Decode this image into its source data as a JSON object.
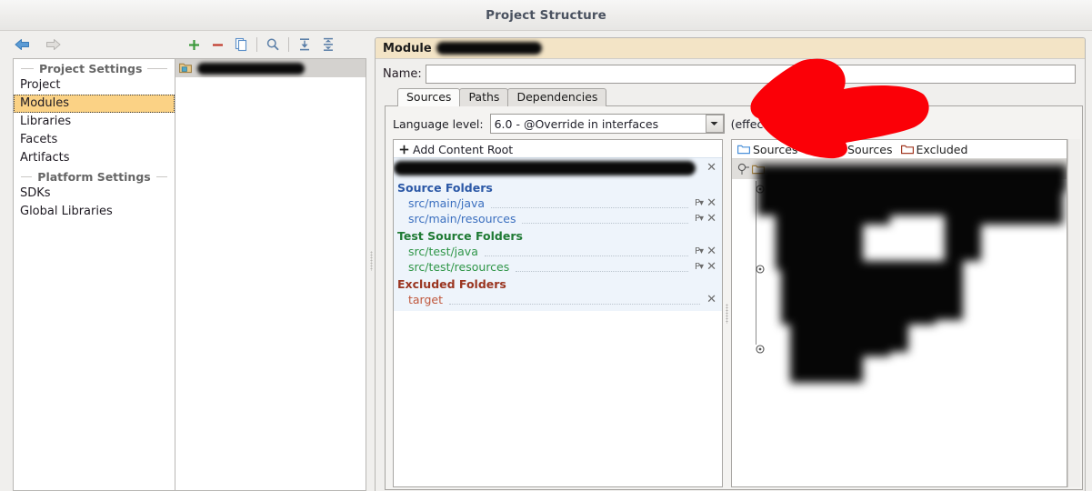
{
  "window": {
    "title": "Project Structure"
  },
  "nav": {
    "back_icon": "arrow-left-icon",
    "forward_icon": "arrow-right-icon"
  },
  "toolbar": {
    "add_icon": "plus-icon",
    "remove_icon": "minus-icon",
    "copy_icon": "copy-icon",
    "search_icon": "search-icon",
    "expand_all_icon": "expand-all-icon",
    "collapse_all_icon": "collapse-all-icon"
  },
  "sidebar": {
    "sections": [
      {
        "title": "Project Settings",
        "items": [
          {
            "label": "Project",
            "selected": false
          },
          {
            "label": "Modules",
            "selected": true
          },
          {
            "label": "Libraries",
            "selected": false
          },
          {
            "label": "Facets",
            "selected": false
          },
          {
            "label": "Artifacts",
            "selected": false
          }
        ]
      },
      {
        "title": "Platform Settings",
        "items": [
          {
            "label": "SDKs",
            "selected": false
          },
          {
            "label": "Global Libraries",
            "selected": false
          }
        ]
      }
    ]
  },
  "module_list": {
    "rows": [
      {
        "label": "",
        "redacted": true,
        "selected": true
      }
    ]
  },
  "detail": {
    "banner_label": "Module",
    "banner_value": "",
    "banner_redacted": true,
    "name_label": "Name:",
    "name_value": "",
    "name_redacted": true,
    "tabs": [
      {
        "label": "Sources",
        "active": true
      },
      {
        "label": "Paths",
        "active": false
      },
      {
        "label": "Dependencies",
        "active": false
      }
    ],
    "language_level": {
      "label": "Language level:",
      "value": "6.0 - @Override in interfaces",
      "note": "(effective on project reload)",
      "dropdown_icon": "chevron-down-icon"
    },
    "content_roots": {
      "add_label": "Add Content Root",
      "add_icon": "plus-icon",
      "root_path": "",
      "root_redacted": true,
      "remove_icon": "close-icon",
      "groups": [
        {
          "title": "Source Folders",
          "kind": "src",
          "folders": [
            {
              "path": "src/main/java",
              "has_package_prefix": true
            },
            {
              "path": "src/main/resources",
              "has_package_prefix": true
            }
          ]
        },
        {
          "title": "Test Source Folders",
          "kind": "test",
          "folders": [
            {
              "path": "src/test/java",
              "has_package_prefix": true
            },
            {
              "path": "src/test/resources",
              "has_package_prefix": true
            }
          ]
        },
        {
          "title": "Excluded Folders",
          "kind": "excl",
          "folders": [
            {
              "path": "target",
              "has_package_prefix": false
            }
          ]
        }
      ]
    },
    "tree_panel": {
      "legend": [
        {
          "label": "Sources",
          "icon": "folder-icon",
          "color": "#4a90d9"
        },
        {
          "label": "Test Sources",
          "icon": "folder-icon",
          "color": "#2f7a3e"
        },
        {
          "label": "Excluded",
          "icon": "folder-icon",
          "color": "#a33b25"
        }
      ],
      "rows": [
        {
          "depth": 0,
          "redacted": true,
          "selected": true,
          "expander": "expanded"
        },
        {
          "depth": 1,
          "redacted": true,
          "selected": false,
          "expander": "expanded"
        },
        {
          "depth": 2,
          "redacted": true,
          "selected": false,
          "expander": "none"
        },
        {
          "depth": 2,
          "redacted": true,
          "selected": false,
          "expander": "none"
        },
        {
          "depth": 2,
          "redacted": true,
          "selected": false,
          "expander": "none"
        },
        {
          "depth": 2,
          "redacted": true,
          "selected": false,
          "expander": "none"
        },
        {
          "depth": 1,
          "redacted": true,
          "selected": false,
          "expander": "expanded"
        },
        {
          "depth": 2,
          "redacted": true,
          "selected": false,
          "expander": "collapsed"
        },
        {
          "depth": 2,
          "redacted": true,
          "selected": false,
          "expander": "collapsed"
        },
        {
          "depth": 2,
          "redacted": true,
          "selected": false,
          "expander": "collapsed"
        },
        {
          "depth": 1,
          "redacted": true,
          "selected": false,
          "expander": "expanded"
        },
        {
          "depth": 2,
          "redacted": true,
          "selected": false,
          "expander": "collapsed"
        },
        {
          "depth": 2,
          "redacted": true,
          "selected": false,
          "expander": "collapsed"
        }
      ]
    }
  },
  "annotation": {
    "shape": "hand-drawn-arrow",
    "color": "#fb0007",
    "points_to": "name-field"
  },
  "colors": {
    "selection_amber": "#fbd285",
    "banner_amber": "#f3e4c6",
    "source_blue": "#3b6fbf",
    "test_green": "#2f9648",
    "excluded_red": "#c0573c",
    "annotation_red": "#fb0007"
  }
}
